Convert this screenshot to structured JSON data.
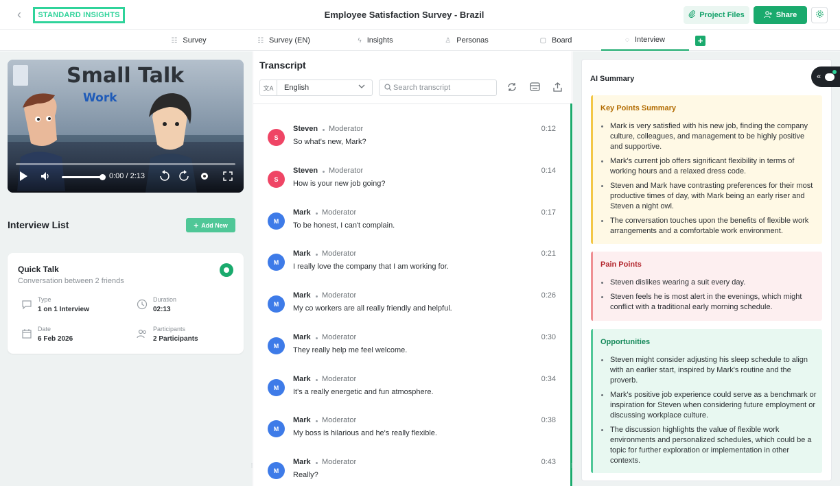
{
  "header": {
    "logo_text": "STANDARD INSIGHTS",
    "title": "Employee Satisfaction Survey - Brazil",
    "project_files_label": "Project Files",
    "share_label": "Share",
    "accent_color": "#1aaa6d"
  },
  "tabs": [
    {
      "label": "Survey",
      "icon": "list-icon"
    },
    {
      "label": "Survey (EN)",
      "icon": "list-icon"
    },
    {
      "label": "Insights",
      "icon": "sparkle-icon"
    },
    {
      "label": "Personas",
      "icon": "users-icon"
    },
    {
      "label": "Board",
      "icon": "board-icon"
    },
    {
      "label": "Interview",
      "icon": "chat-icon",
      "active": true
    }
  ],
  "video": {
    "title": "Small Talk",
    "subtitle": "Work",
    "time_display": "0:00 / 2:13",
    "progress": 0
  },
  "interview_list": {
    "title": "Interview List",
    "add_label": "Add New",
    "card": {
      "title": "Quick Talk",
      "subtitle": "Conversation between 2 friends",
      "type_label": "Type",
      "type_value": "1 on 1 Interview",
      "duration_label": "Duration",
      "duration_value": "02:13",
      "date_label": "Date",
      "date_value": "6 Feb 2026",
      "participants_label": "Participants",
      "participants_value": "2 Participants"
    }
  },
  "transcript": {
    "title": "Transcript",
    "language": "English",
    "search_placeholder": "Search transcript",
    "messages": [
      {
        "initial": "S",
        "speaker": "Steven",
        "role": "Moderator",
        "time": "0:12",
        "text": "So what's new, Mark?",
        "color": "#ef4565"
      },
      {
        "initial": "S",
        "speaker": "Steven",
        "role": "Moderator",
        "time": "0:14",
        "text": "How is your new job going?",
        "color": "#ef4565"
      },
      {
        "initial": "M",
        "speaker": "Mark",
        "role": "Moderator",
        "time": "0:17",
        "text": "To be honest, I can't complain.",
        "color": "#3e7be8"
      },
      {
        "initial": "M",
        "speaker": "Mark",
        "role": "Moderator",
        "time": "0:21",
        "text": "I really love the company that I am working for.",
        "color": "#3e7be8"
      },
      {
        "initial": "M",
        "speaker": "Mark",
        "role": "Moderator",
        "time": "0:26",
        "text": "My co workers are all really friendly and helpful.",
        "color": "#3e7be8"
      },
      {
        "initial": "M",
        "speaker": "Mark",
        "role": "Moderator",
        "time": "0:30",
        "text": "They really help me feel welcome.",
        "color": "#3e7be8"
      },
      {
        "initial": "M",
        "speaker": "Mark",
        "role": "Moderator",
        "time": "0:34",
        "text": "It's a really energetic and fun atmosphere.",
        "color": "#3e7be8"
      },
      {
        "initial": "M",
        "speaker": "Mark",
        "role": "Moderator",
        "time": "0:38",
        "text": "My boss is hilarious and he's really flexible.",
        "color": "#3e7be8"
      },
      {
        "initial": "M",
        "speaker": "Mark",
        "role": "Moderator",
        "time": "0:43",
        "text": "Really?",
        "color": "#3e7be8"
      }
    ]
  },
  "summary": {
    "title": "AI Summary",
    "key_points": {
      "heading": "Key Points Summary",
      "items": [
        "Mark is very satisfied with his new job, finding the company culture, colleagues, and management to be highly positive and supportive.",
        "Mark's current job offers significant flexibility in terms of working hours and a relaxed dress code.",
        "Steven and Mark have contrasting preferences for their most productive times of day, with Mark being an early riser and Steven a night owl.",
        "The conversation touches upon the benefits of flexible work arrangements and a comfortable work environment."
      ]
    },
    "pain_points": {
      "heading": "Pain Points",
      "items": [
        "Steven dislikes wearing a suit every day.",
        "Steven feels he is most alert in the evenings, which might conflict with a traditional early morning schedule."
      ]
    },
    "opportunities": {
      "heading": "Opportunities",
      "items": [
        "Steven might consider adjusting his sleep schedule to align with an earlier start, inspired by Mark's routine and the proverb.",
        "Mark's positive job experience could serve as a benchmark or inspiration for Steven when considering future employment or discussing workplace culture.",
        "The discussion highlights the value of flexible work environments and personalized schedules, which could be a topic for further exploration or implementation in other contexts."
      ]
    }
  }
}
